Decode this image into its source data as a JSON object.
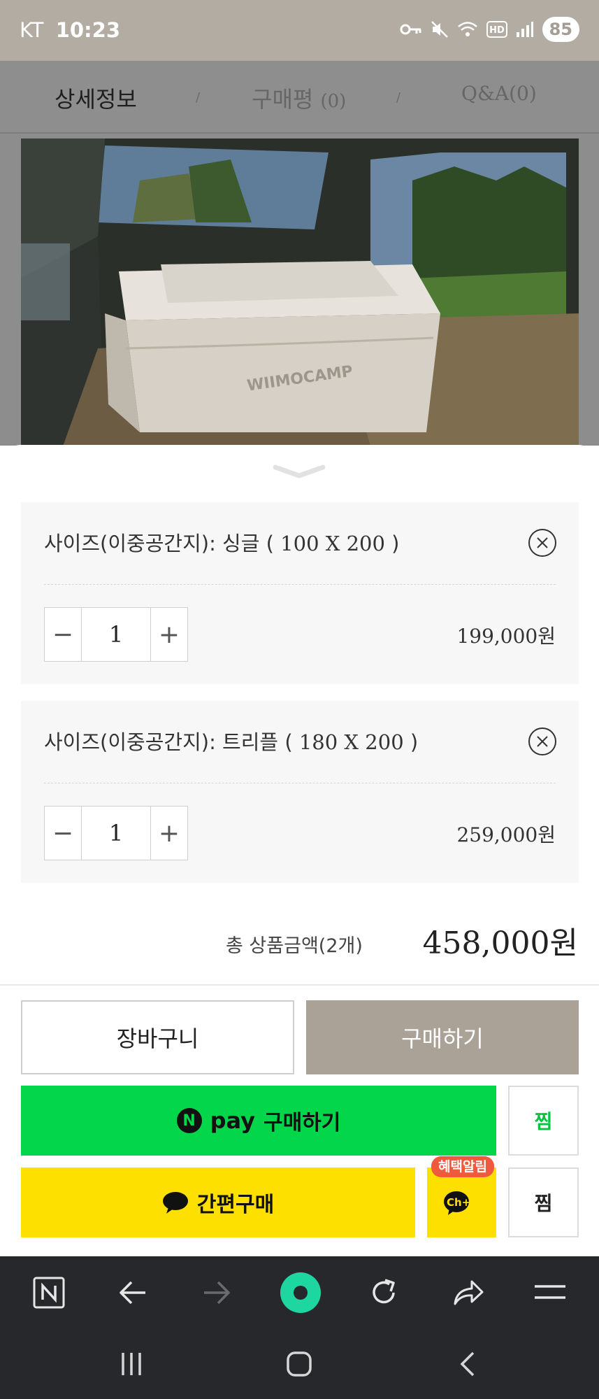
{
  "status_bar": {
    "carrier": "KT",
    "time": "10:23",
    "battery": "85",
    "icons": [
      "key-icon",
      "mute-icon",
      "wifi-icon",
      "hd-icon",
      "signal-icon",
      "battery-icon"
    ]
  },
  "tabs": [
    {
      "label": "상세정보",
      "count": ""
    },
    {
      "label": "구매평",
      "count": "(0)"
    },
    {
      "label": "Q&A(0)",
      "count": ""
    }
  ],
  "tab_separator": "/",
  "product_image": {
    "brand_text": "WIIMOCAMP"
  },
  "options": [
    {
      "name_prefix": "사이즈(이중공간지): 싱글 ( ",
      "name_spec": "100 X 200",
      "name_suffix": " )",
      "quantity": "1",
      "price": "199,000원"
    },
    {
      "name_prefix": "사이즈(이중공간지): 트리플 ( ",
      "name_spec": "180 X 200",
      "name_suffix": " )",
      "quantity": "1",
      "price": "259,000원"
    }
  ],
  "stepper": {
    "minus": "−",
    "plus": "+"
  },
  "total": {
    "label": "총 상품금액(2개)",
    "price": "458,000원"
  },
  "buttons": {
    "cart": "장바구니",
    "buy": "구매하기",
    "npay_logo": "N",
    "npay_word": "pay",
    "npay_label": "구매하기",
    "zzim_npay": "찜",
    "kakao_label": "간편구매",
    "ch_badge": "혜택알림",
    "ch_label": "Ch+",
    "zzim_kakao": "찜"
  },
  "colors": {
    "status_bar": "#b3aca3",
    "buy_button": "#aaa297",
    "npay_green": "#03d64a",
    "kakao_yellow": "#fee000",
    "badge_red": "#ef5a3d",
    "browser_bar": "#27282c",
    "home_accent": "#1ed7a0"
  },
  "browser_toolbar": {
    "icons": [
      "naver-n-icon",
      "back-arrow-icon",
      "forward-arrow-icon",
      "home-circle-icon",
      "refresh-icon",
      "share-icon",
      "menu-icon"
    ]
  },
  "system_nav": {
    "icons": [
      "recents-icon",
      "home-icon",
      "back-icon"
    ]
  }
}
